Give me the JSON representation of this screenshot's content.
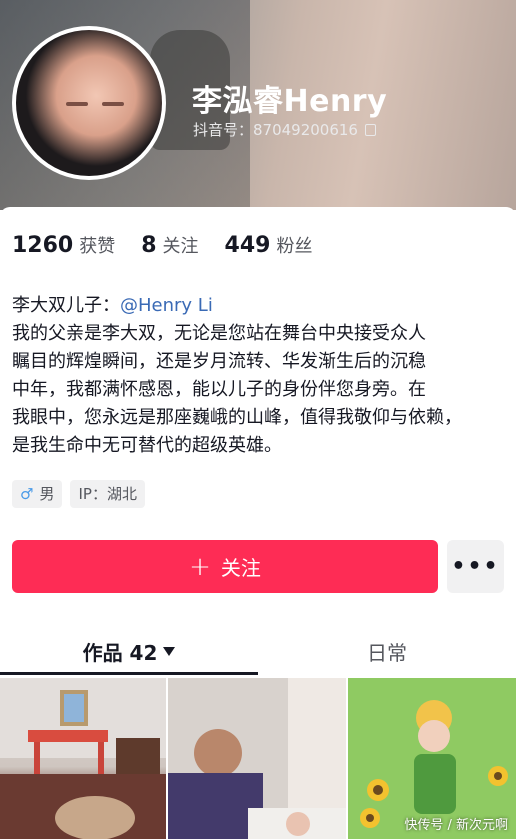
{
  "profile": {
    "name": "李泓睿Henry",
    "douyin_id_label": "抖音号：87049200616"
  },
  "stats": [
    {
      "num": "1260",
      "label": "获赞"
    },
    {
      "num": "8",
      "label": "关注"
    },
    {
      "num": "449",
      "label": "粉丝"
    }
  ],
  "bio": {
    "prefix": "李大双儿子：",
    "mention": "@Henry Li",
    "lines": [
      "我的父亲是李大双，无论是您站在舞台中央接受众人",
      "瞩目的辉煌瞬间，还是岁月流转、华发渐生后的沉稳",
      "中年，我都满怀感恩，能以儿子的身份伴您身旁。在",
      "我眼中，您永远是那座巍峨的山峰，值得我敬仰与依赖，",
      "是我生命中无可替代的超级英雄。"
    ]
  },
  "tags": {
    "gender": "男",
    "gender_symbol": "♂",
    "ip": "IP：湖北"
  },
  "actions": {
    "follow_label": "关注",
    "plus": "+",
    "more": "•••"
  },
  "tabs": {
    "works": "作品 42",
    "daily": "日常"
  },
  "watermark": "快传号 / 新次元啊"
}
